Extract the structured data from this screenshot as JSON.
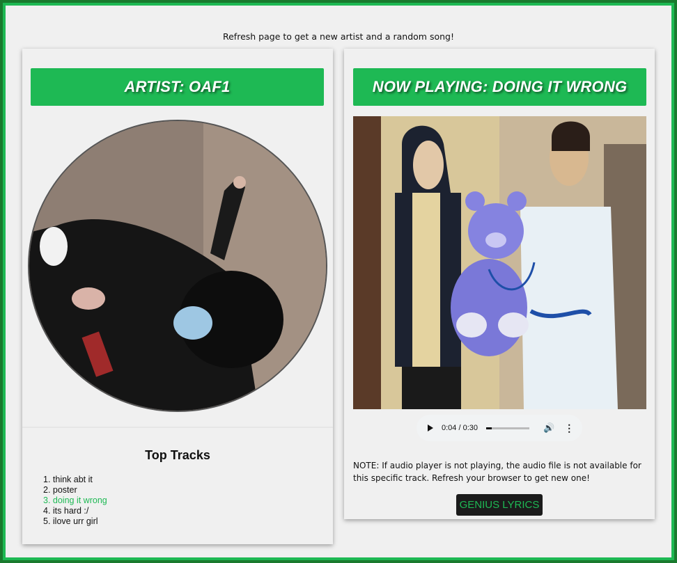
{
  "header": {
    "refresh_note": "Refresh page to get a new artist and a random song!"
  },
  "artist_card": {
    "banner": "ARTIST: OAF1",
    "top_tracks_title": "Top Tracks",
    "tracks": [
      "think abt it",
      "poster",
      "doing it wrong",
      "its hard :/",
      "ilove urr girl"
    ],
    "active_track_index": 2
  },
  "player_card": {
    "banner": "NOW PLAYING: DOING IT WRONG",
    "audio": {
      "time": "0:04 / 0:30",
      "progress": 0.13
    },
    "note": "NOTE: If audio player is not playing, the audio file is not available for this specific track. Refresh your browser to get new one!",
    "genius_button": "GENIUS LYRICS"
  },
  "colors": {
    "accent": "#1eb954",
    "border_dark": "#1a7a2e",
    "background": "#f0f0f0"
  },
  "icons": {
    "play": "play-icon",
    "volume": "volume-icon",
    "more": "more-options-icon"
  }
}
